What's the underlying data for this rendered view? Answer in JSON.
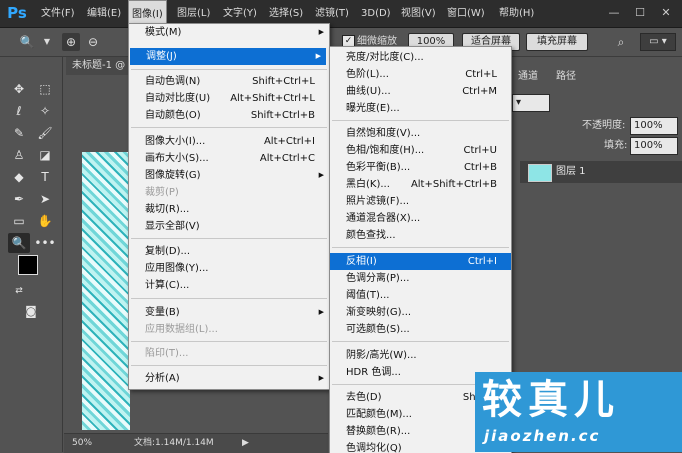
{
  "menubar": {
    "logo": "Ps",
    "items": [
      "文件(F)",
      "编辑(E)",
      "图像(I)",
      "图层(L)",
      "文字(Y)",
      "选择(S)",
      "滤镜(T)",
      "3D(D)",
      "视图(V)",
      "窗口(W)",
      "帮助(H)"
    ],
    "active_index": 2,
    "window_controls": [
      "—",
      "☐",
      "✕"
    ]
  },
  "options_bar": {
    "scrubby_zoom_label": "细微缩放",
    "scrubby_zoom_checked": true,
    "zoom_percent": "100%",
    "fit_screen": "适合屏幕",
    "fill_screen": "填充屏幕"
  },
  "document": {
    "tab_title": "未标题-1 @ 50%",
    "status_zoom": "50%",
    "status_doc": "文档:1.14M/1.14M"
  },
  "right_panel": {
    "tabs": [
      "通道",
      "路径"
    ],
    "opacity_label": "不透明度:",
    "opacity_value": "100%",
    "fill_label": "填充:",
    "fill_value": "100%",
    "layer_name": "图层 1"
  },
  "image_menu": {
    "items": [
      {
        "label": "模式(M)",
        "shortcut": "",
        "submenu": true,
        "disabled": false,
        "highlight": false
      },
      {
        "label": "调整(J)",
        "shortcut": "",
        "submenu": true,
        "disabled": false,
        "highlight": true
      },
      {
        "label": "自动色调(N)",
        "shortcut": "Shift+Ctrl+L",
        "submenu": false,
        "disabled": false,
        "highlight": false
      },
      {
        "label": "自动对比度(U)",
        "shortcut": "Alt+Shift+Ctrl+L",
        "submenu": false,
        "disabled": false,
        "highlight": false
      },
      {
        "label": "自动颜色(O)",
        "shortcut": "Shift+Ctrl+B",
        "submenu": false,
        "disabled": false,
        "highlight": false
      },
      {
        "label": "图像大小(I)...",
        "shortcut": "Alt+Ctrl+I",
        "submenu": false,
        "disabled": false,
        "highlight": false
      },
      {
        "label": "画布大小(S)...",
        "shortcut": "Alt+Ctrl+C",
        "submenu": false,
        "disabled": false,
        "highlight": false
      },
      {
        "label": "图像旋转(G)",
        "shortcut": "",
        "submenu": true,
        "disabled": false,
        "highlight": false
      },
      {
        "label": "裁剪(P)",
        "shortcut": "",
        "submenu": false,
        "disabled": true,
        "highlight": false
      },
      {
        "label": "裁切(R)...",
        "shortcut": "",
        "submenu": false,
        "disabled": false,
        "highlight": false
      },
      {
        "label": "显示全部(V)",
        "shortcut": "",
        "submenu": false,
        "disabled": false,
        "highlight": false
      },
      {
        "label": "复制(D)...",
        "shortcut": "",
        "submenu": false,
        "disabled": false,
        "highlight": false
      },
      {
        "label": "应用图像(Y)...",
        "shortcut": "",
        "submenu": false,
        "disabled": false,
        "highlight": false
      },
      {
        "label": "计算(C)...",
        "shortcut": "",
        "submenu": false,
        "disabled": false,
        "highlight": false
      },
      {
        "label": "变量(B)",
        "shortcut": "",
        "submenu": true,
        "disabled": false,
        "highlight": false
      },
      {
        "label": "应用数据组(L)...",
        "shortcut": "",
        "submenu": false,
        "disabled": true,
        "highlight": false
      },
      {
        "label": "陷印(T)...",
        "shortcut": "",
        "submenu": false,
        "disabled": true,
        "highlight": false
      },
      {
        "label": "分析(A)",
        "shortcut": "",
        "submenu": true,
        "disabled": false,
        "highlight": false
      }
    ]
  },
  "adjust_submenu": {
    "items": [
      {
        "label": "亮度/对比度(C)...",
        "shortcut": "",
        "highlight": false
      },
      {
        "label": "色阶(L)...",
        "shortcut": "Ctrl+L",
        "highlight": false
      },
      {
        "label": "曲线(U)...",
        "shortcut": "Ctrl+M",
        "highlight": false
      },
      {
        "label": "曝光度(E)...",
        "shortcut": "",
        "highlight": false
      },
      {
        "label": "自然饱和度(V)...",
        "shortcut": "",
        "highlight": false
      },
      {
        "label": "色相/饱和度(H)...",
        "shortcut": "Ctrl+U",
        "highlight": false
      },
      {
        "label": "色彩平衡(B)...",
        "shortcut": "Ctrl+B",
        "highlight": false
      },
      {
        "label": "黑白(K)...",
        "shortcut": "Alt+Shift+Ctrl+B",
        "highlight": false
      },
      {
        "label": "照片滤镜(F)...",
        "shortcut": "",
        "highlight": false
      },
      {
        "label": "通道混合器(X)...",
        "shortcut": "",
        "highlight": false
      },
      {
        "label": "颜色查找...",
        "shortcut": "",
        "highlight": false
      },
      {
        "label": "反相(I)",
        "shortcut": "Ctrl+I",
        "highlight": true
      },
      {
        "label": "色调分离(P)...",
        "shortcut": "",
        "highlight": false
      },
      {
        "label": "阈值(T)...",
        "shortcut": "",
        "highlight": false
      },
      {
        "label": "渐变映射(G)...",
        "shortcut": "",
        "highlight": false
      },
      {
        "label": "可选颜色(S)...",
        "shortcut": "",
        "highlight": false
      },
      {
        "label": "阴影/高光(W)...",
        "shortcut": "",
        "highlight": false
      },
      {
        "label": "HDR 色调...",
        "shortcut": "",
        "highlight": false
      },
      {
        "label": "去色(D)",
        "shortcut": "Shift+Ctr",
        "highlight": false
      },
      {
        "label": "匹配颜色(M)...",
        "shortcut": "",
        "highlight": false
      },
      {
        "label": "替换颜色(R)...",
        "shortcut": "",
        "highlight": false
      },
      {
        "label": "色调均化(Q)",
        "shortcut": "",
        "highlight": false
      }
    ]
  },
  "watermark": {
    "line1": "较真儿",
    "line2": "jiaozhen.cc"
  }
}
